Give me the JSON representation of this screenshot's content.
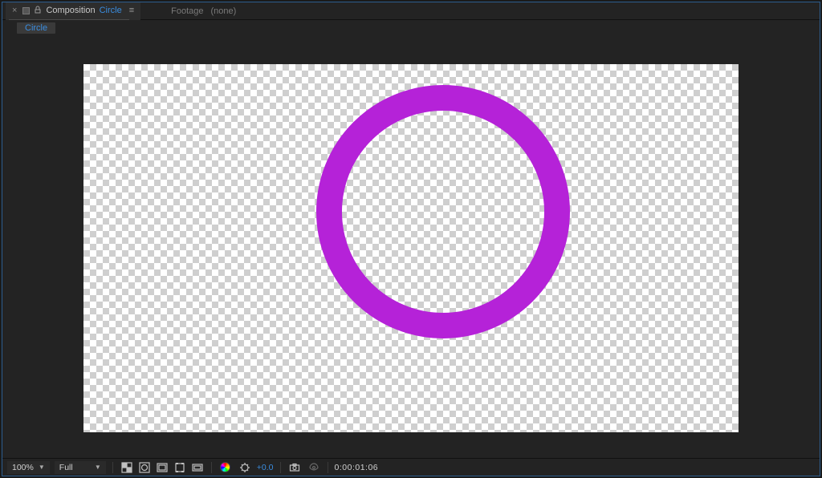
{
  "tabs": {
    "composition": {
      "label": "Composition",
      "comp_name": "Circle"
    },
    "footage": {
      "label": "Footage",
      "value": "(none)"
    }
  },
  "breadcrumb": {
    "current": "Circle"
  },
  "canvas": {
    "shape_color": "#b522d8"
  },
  "footer": {
    "zoom": "100%",
    "resolution": "Full",
    "exposure": "+0.0",
    "timecode": "0:00:01:06"
  },
  "icons": {
    "close": "close-icon",
    "square": "square-icon",
    "lock": "lock-icon",
    "panel_menu": "panel-menu-icon",
    "chevron_down": "chevron-down-icon",
    "grid": "transparency-grid-icon",
    "mask": "toggle-mask-icon",
    "safe": "safe-zones-icon",
    "roi": "region-of-interest-icon",
    "channels": "channels-icon",
    "color": "color-management-icon",
    "reset_exposure": "reset-exposure-icon",
    "snapshot": "snapshot-icon",
    "show_snapshot": "show-snapshot-icon"
  }
}
